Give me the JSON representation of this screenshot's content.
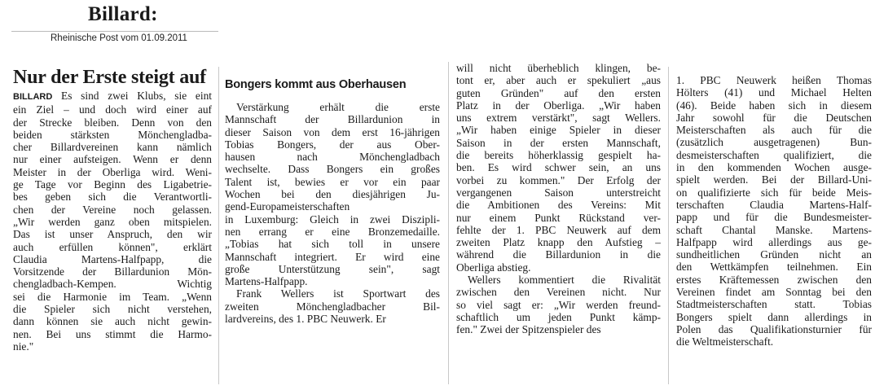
{
  "header": {
    "title": "Billard:",
    "source": "Rheinische Post vom 01.09.2011"
  },
  "article1": {
    "headline": "Nur der Erste steigt auf",
    "kicker": "BILLARD",
    "lines": [
      " Es sind zwei Klubs, sie eint",
      "ein Ziel – und doch wird einer auf",
      "der Strecke bleiben. Denn von den",
      "beiden stärksten Mönchengladba-",
      "cher Billardvereinen kann nämlich",
      "nur einer aufsteigen. Wenn er denn",
      "Meister in der Oberliga wird. Weni-",
      "ge Tage vor Beginn des Ligabetrie-",
      "bes geben sich die Verantwortli-",
      "chen der Vereine noch gelassen.",
      "„Wir werden ganz oben mitspielen.",
      "Das ist unser Anspruch, den wir",
      "auch erfüllen können\", erklärt",
      "Claudia Martens-Halfpapp, die",
      "Vorsitzende der Billardunion Mön-",
      "chengladbach-Kempen. Wichtig",
      "sei die Harmonie im Team. „Wenn",
      "die Spieler sich nicht verstehen,",
      "dann können sie auch nicht gewin-",
      "nen. Bei uns stimmt die Harmo-",
      "nie.\""
    ]
  },
  "article2": {
    "headline": "Bongers kommt aus Oberhausen",
    "lines": [
      "Verstärkung erhält die erste",
      "Mannschaft der Billardunion in",
      "dieser Saison von dem erst 16-jährigen",
      "Tobias Bongers, der aus Ober-",
      "hausen nach Mönchengladbach",
      "wechselte. Dass Bongers ein großes",
      "Talent ist, bewies er vor ein paar",
      "Wochen bei den diesjährigen Ju-",
      "gend-Europameisterschaften",
      "in Luxemburg: Gleich in zwei Diszipli-",
      "nen errang er eine Bronzemedaille.",
      "„Tobias hat sich toll in unsere",
      "Mannschaft integriert. Er wird eine",
      "große Unterstützung sein\", sagt",
      "Martens-Halfpapp.",
      "Frank Wellers ist Sportwart des",
      "zweiten Mönchengladbacher Bil-",
      "lardvereins, des 1. PBC Neuwerk. Er"
    ]
  },
  "article3": {
    "lines": [
      "will nicht überheblich klingen, be-",
      "tont er, aber auch er spekuliert „aus",
      "guten Gründen\" auf den ersten",
      "Platz in der Oberliga. „Wir haben",
      "uns extrem verstärkt\", sagt Wellers.",
      "„Wir haben einige Spieler in dieser",
      "Saison in der ersten Mannschaft,",
      "die bereits höherklassig gespielt ha-",
      "ben. Es wird schwer sein, an uns",
      "vorbei zu kommen.\" Der Erfolg der",
      "vergangenen Saison unterstreicht",
      "die Ambitionen des Vereins: Mit",
      "nur einem Punkt Rückstand ver-",
      "fehlte der 1. PBC Neuwerk auf dem",
      "zweiten Platz knapp den Aufstieg –",
      "während die Billardunion in die",
      "Oberliga abstieg.",
      "Wellers kommentiert die Rivalität",
      "zwischen den Vereinen nicht. Nur",
      "so viel sagt er: „Wir werden freund-",
      "schaftlich um jeden Punkt kämp-",
      "fen.\" Zwei der Spitzenspieler des"
    ]
  },
  "article4": {
    "lines": [
      "1. PBC Neuwerk heißen Thomas",
      "Hölters (41) und Michael Helten",
      "(46). Beide haben sich in diesem",
      "Jahr sowohl für die Deutschen",
      "Meisterschaften als auch für die",
      "(zusätzlich ausgetragenen) Bun-",
      "desmeisterschaften qualifiziert, die",
      "in den kommenden Wochen ausge-",
      "spielt werden. Bei der Billard-Uni-",
      "on qualifizierte sich für beide Meis-",
      "terschaften Claudia Martens-Half-",
      "papp und für die Bundesmeister-",
      "schaft Chantal Manske. Martens-",
      "Halfpapp wird allerdings aus ge-",
      "sundheitlichen Gründen nicht an",
      "den Wettkämpfen teilnehmen. Ein",
      "erstes Kräftemessen zwischen den",
      "Vereinen findet am Sonntag bei den",
      "Stadtmeisterschaften statt. Tobias",
      "Bongers spielt dann allerdings in",
      "Polen das Qualifikationsturnier für",
      "die Weltmeisterschaft."
    ]
  }
}
